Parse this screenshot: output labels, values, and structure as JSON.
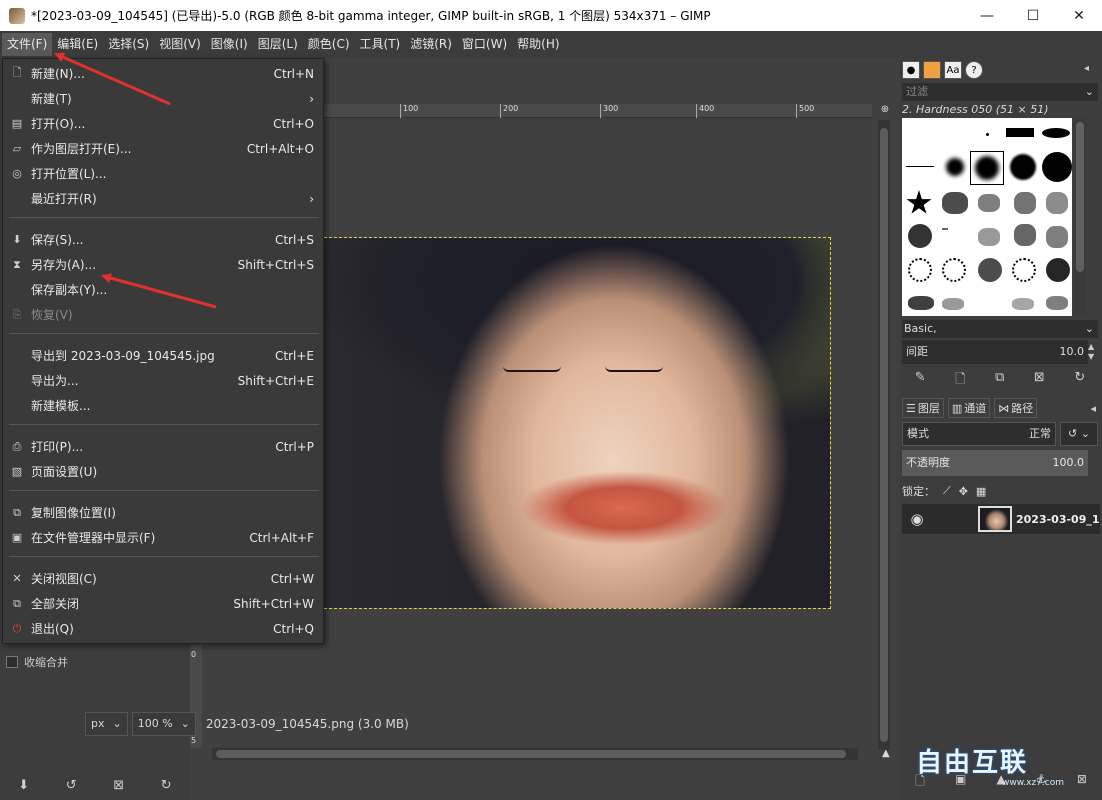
{
  "window": {
    "title": "*[2023-03-09_104545] (已导出)-5.0 (RGB 颜色 8-bit gamma integer, GIMP built-in sRGB, 1 个图层) 534x371 – GIMP",
    "min_label": "—",
    "max_label": "☐",
    "close_label": "✕"
  },
  "menubar": {
    "items": [
      "文件(F)",
      "编辑(E)",
      "选择(S)",
      "视图(V)",
      "图像(I)",
      "图层(L)",
      "颜色(C)",
      "工具(T)",
      "滤镜(R)",
      "窗口(W)",
      "帮助(H)"
    ]
  },
  "file_menu": {
    "items": [
      {
        "label": "新建(N)...",
        "shortcut": "Ctrl+N",
        "icon": "new-icon"
      },
      {
        "label": "新建(T)",
        "shortcut": "›",
        "icon": ""
      },
      {
        "label": "打开(O)...",
        "shortcut": "Ctrl+O",
        "icon": "open-icon"
      },
      {
        "label": "作为图层打开(E)...",
        "shortcut": "Ctrl+Alt+O",
        "icon": "open-as-layer-icon"
      },
      {
        "label": "打开位置(L)...",
        "shortcut": "",
        "icon": "globe-icon"
      },
      {
        "label": "最近打开(R)",
        "shortcut": "›",
        "icon": ""
      },
      {
        "label": "保存(S)...",
        "shortcut": "Ctrl+S",
        "icon": "save-icon"
      },
      {
        "label": "另存为(A)...",
        "shortcut": "Shift+Ctrl+S",
        "icon": "save-as-icon"
      },
      {
        "label": "保存副本(Y)...",
        "shortcut": "",
        "icon": ""
      },
      {
        "label": "恢复(V)",
        "shortcut": "",
        "icon": "revert-icon",
        "disabled": true
      },
      {
        "label": "导出到 2023-03-09_104545.jpg",
        "shortcut": "Ctrl+E",
        "icon": ""
      },
      {
        "label": "导出为...",
        "shortcut": "Shift+Ctrl+E",
        "icon": ""
      },
      {
        "label": "新建模板...",
        "shortcut": "",
        "icon": ""
      },
      {
        "label": "打印(P)...",
        "shortcut": "Ctrl+P",
        "icon": "print-icon"
      },
      {
        "label": "页面设置(U)",
        "shortcut": "",
        "icon": "page-setup-icon"
      },
      {
        "label": "复制图像位置(I)",
        "shortcut": "",
        "icon": "copy-location-icon"
      },
      {
        "label": "在文件管理器中显示(F)",
        "shortcut": "Ctrl+Alt+F",
        "icon": "file-manager-icon"
      },
      {
        "label": "关闭视图(C)",
        "shortcut": "Ctrl+W",
        "icon": "close-view-icon"
      },
      {
        "label": "全部关闭",
        "shortcut": "Shift+Ctrl+W",
        "icon": "close-all-icon"
      },
      {
        "label": "退出(Q)",
        "shortcut": "Ctrl+Q",
        "icon": "quit-icon"
      }
    ]
  },
  "left_dock": {
    "merge_label": "收缩合并"
  },
  "rulers": {
    "h_ticks": [
      "100",
      "200",
      "300",
      "400",
      "500"
    ],
    "v_ticks": [
      "0",
      "5"
    ]
  },
  "statusbar": {
    "unit": "px",
    "zoom": "100 %",
    "file_info": "2023-03-09_104545.png (3.0 MB)"
  },
  "brushes": {
    "filter_placeholder": "过滤",
    "selected_brush": "2. Hardness 050 (51 × 51)",
    "preset": "Basic,",
    "spacing_label": "间距",
    "spacing_value": "10.0"
  },
  "layers": {
    "tabs": [
      "图层",
      "通道",
      "路径"
    ],
    "mode_label": "模式",
    "mode_value": "正常",
    "opacity_label": "不透明度",
    "opacity_value": "100.0",
    "lock_label": "锁定：",
    "layer_name": "2023-03-09_1"
  },
  "watermark": {
    "text": "自由互联",
    "url": "www.xz7.com"
  },
  "colors": {
    "accent_arrow": "#e03030",
    "selection_marquee": "#e5d24a"
  }
}
